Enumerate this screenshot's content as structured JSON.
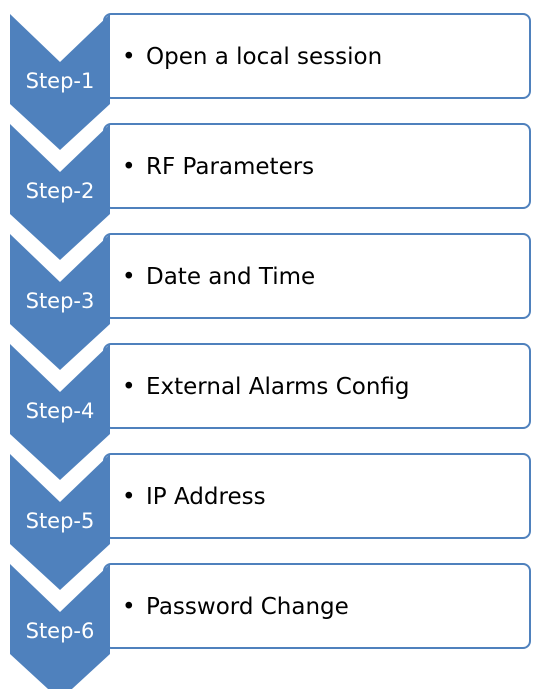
{
  "colors": {
    "chevron_fill": "#4f81bd",
    "box_border": "#4f81bd",
    "box_fill": "#ffffff",
    "step_text": "#ffffff",
    "desc_text": "#000000"
  },
  "bullet": "•",
  "steps": [
    {
      "label": "Step-1",
      "description": "Open a local session"
    },
    {
      "label": "Step-2",
      "description": "RF Parameters"
    },
    {
      "label": "Step-3",
      "description": "Date and Time"
    },
    {
      "label": "Step-4",
      "description": "External Alarms Config"
    },
    {
      "label": "Step-5",
      "description": "IP Address"
    },
    {
      "label": "Step-6",
      "description": "Password Change"
    }
  ]
}
